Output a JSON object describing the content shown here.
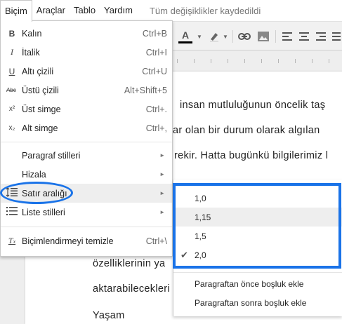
{
  "menubar": {
    "items": [
      "Biçim",
      "Araçlar",
      "Tablo",
      "Yardım"
    ],
    "saved_status": "Tüm değişiklikler kaydedildi"
  },
  "toolbar": {
    "font_color_label": "A"
  },
  "document": {
    "lines": [
      "insan mutluluğunun öncelik taş",
      "ar olan bir durum olarak algılan",
      "rekir. Hatta bugünkü bilgilerimiz l",
      "özelliklerinin ya",
      "aktarabilecekleri",
      "Yaşam"
    ]
  },
  "format_menu": {
    "items": [
      {
        "icon": "bold-icon",
        "glyph": "B",
        "label": "Kalın",
        "shortcut": "Ctrl+B"
      },
      {
        "icon": "italic-icon",
        "glyph": "I",
        "label": "İtalik",
        "shortcut": "Ctrl+I"
      },
      {
        "icon": "underline-icon",
        "glyph": "U",
        "label": "Altı çizili",
        "shortcut": "Ctrl+U"
      },
      {
        "icon": "strikethrough-icon",
        "glyph": "Abc",
        "label": "Üstü çizili",
        "shortcut": "Alt+Shift+5"
      },
      {
        "icon": "superscript-icon",
        "glyph": "x²",
        "label": "Üst simge",
        "shortcut": "Ctrl+."
      },
      {
        "icon": "subscript-icon",
        "glyph": "x₂",
        "label": "Alt simge",
        "shortcut": "Ctrl+,"
      }
    ],
    "submenus": [
      {
        "label": "Paragraf stilleri"
      },
      {
        "label": "Hizala"
      },
      {
        "label": "Satır aralığı",
        "icon": "line-spacing-icon"
      },
      {
        "label": "Liste stilleri",
        "icon": "list-icon"
      }
    ],
    "clear": {
      "label": "Biçimlendirmeyi temizle",
      "shortcut": "Ctrl+\\",
      "icon": "clear-formatting-icon"
    }
  },
  "line_spacing_menu": {
    "options": [
      "1,0",
      "1,15",
      "1,5",
      "2,0"
    ],
    "selected": "2,0",
    "actions": [
      "Paragraftan önce boşluk ekle",
      "Paragraftan sonra boşluk ekle"
    ]
  },
  "colors": {
    "highlight_annotation": "#1a73e8",
    "hover_bg": "#eeeeee"
  }
}
